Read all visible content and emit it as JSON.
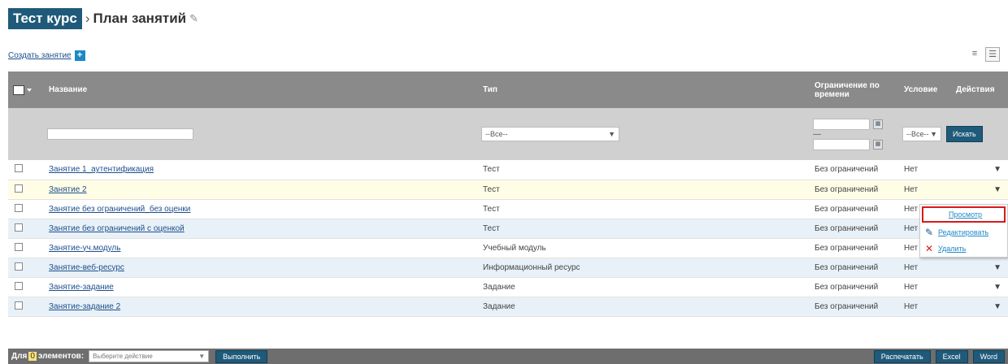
{
  "header": {
    "course": "Тест курс",
    "separator": "›",
    "title": "План занятий",
    "edit_icon": "✎"
  },
  "toolbar": {
    "create_label": "Создать занятие",
    "create_icon": "+",
    "view_icons": [
      "list-view-icon",
      "table-view-icon"
    ]
  },
  "table": {
    "columns": [
      "Название",
      "Тип",
      "Ограничение по времени",
      "Условие",
      "Действия"
    ],
    "filter": {
      "type_value": "--Все--",
      "condition_value": "--Все--",
      "search_label": "Искать",
      "date_dash": "—"
    },
    "rows": [
      {
        "name": "Занятие 1_аутентификация",
        "type": "Тест",
        "limit": "Без ограничений",
        "condition": "Нет"
      },
      {
        "name": "Занятие 2",
        "type": "Тест",
        "limit": "Без ограничений",
        "condition": "Нет"
      },
      {
        "name": "Занятие без ограничений_без оценки",
        "type": "Тест",
        "limit": "Без ограничений",
        "condition": "Нет"
      },
      {
        "name": "Занятие без ограничений с оценкой",
        "type": "Тест",
        "limit": "Без ограничений",
        "condition": "Нет"
      },
      {
        "name": "Занятие-уч.модуль",
        "type": "Учебный модуль",
        "limit": "Без ограничений",
        "condition": "Нет"
      },
      {
        "name": "Занятие-веб-ресурс",
        "type": "Информационный ресурс",
        "limit": "Без ограничений",
        "condition": "Нет"
      },
      {
        "name": "Занятие-задание",
        "type": "Задание",
        "limit": "Без ограничений",
        "condition": "Нет"
      },
      {
        "name": "Занятие-задание 2",
        "type": "Задание",
        "limit": "Без ограничений",
        "condition": "Нет"
      }
    ]
  },
  "context_menu": {
    "view": "Просмотр",
    "edit": "Редактировать",
    "delete": "Удалить"
  },
  "footer": {
    "label_prefix": "Для",
    "count": "0",
    "label_suffix": "элементов:",
    "select_placeholder": "Выберите действие",
    "run_label": "Выполнить",
    "print_label": "Распечатать",
    "excel_label": "Excel",
    "word_label": "Word"
  },
  "colors": {
    "accent": "#1f5a7a",
    "header_bg": "#8a8a8a",
    "highlight_border": "#d71a1a"
  }
}
